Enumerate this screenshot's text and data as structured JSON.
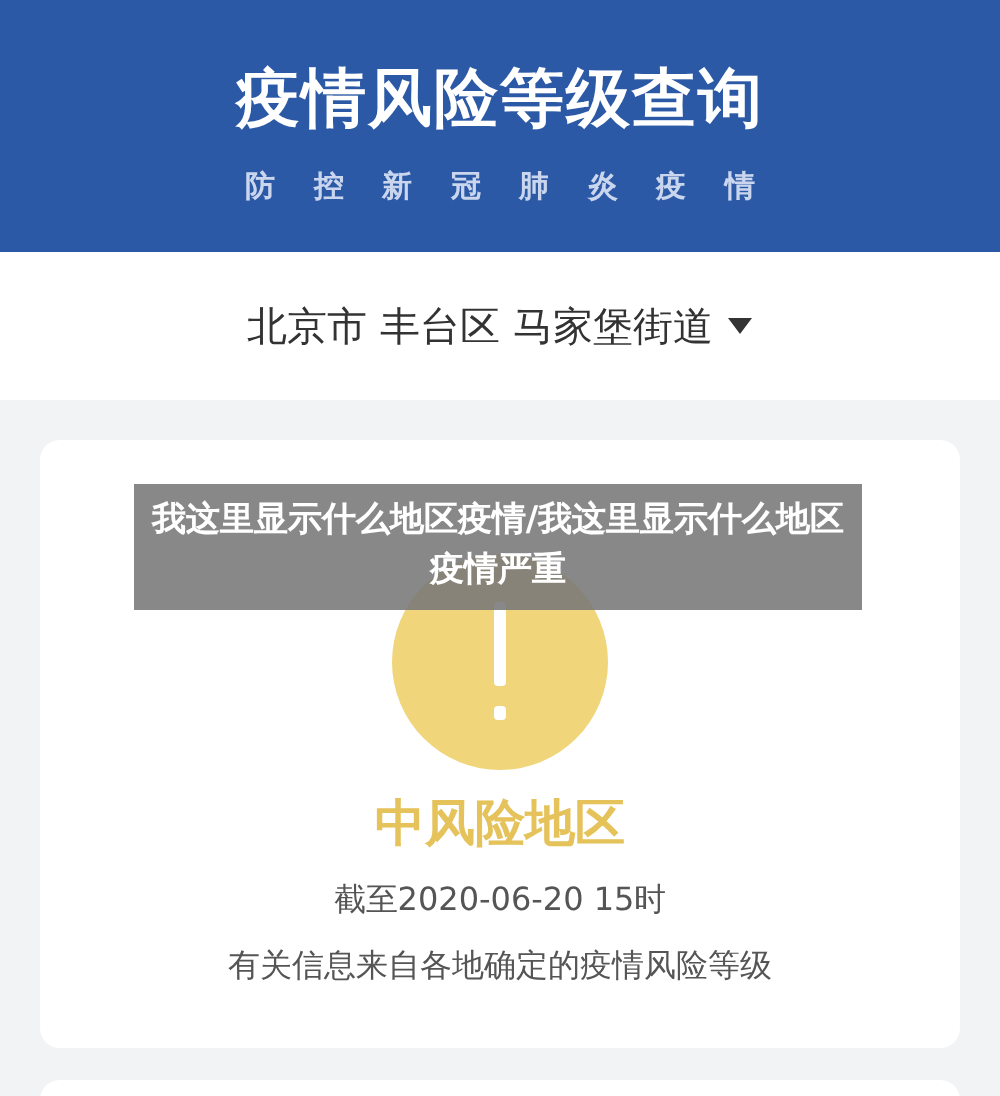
{
  "header": {
    "title": "疫情风险等级查询",
    "subtitle": "防 控 新 冠 肺 炎 疫 情"
  },
  "location": {
    "text": "北京市 丰台区 马家堡街道"
  },
  "risk_card": {
    "kind": "medium",
    "level_text": "中风险地区",
    "as_of": "截至2020-06-20 15时",
    "note": "有关信息来自各地确定的疫情风险等级"
  },
  "caption": {
    "text": "我这里显示什么地区疫情/我这里显示什么地区疫情严重"
  }
}
